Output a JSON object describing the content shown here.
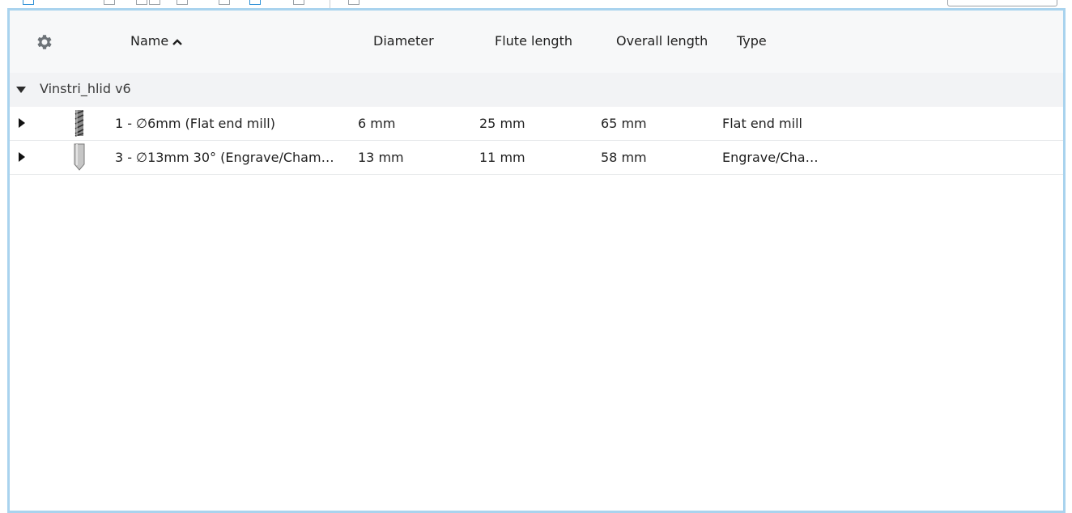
{
  "columns": {
    "name": "Name",
    "diameter": "Diameter",
    "flute_length": "Flute length",
    "overall_length": "Overall length",
    "type": "Type"
  },
  "sort": {
    "column": "Name",
    "direction": "ascending",
    "icon": "chevron-up-icon"
  },
  "settings_icon": "gear-icon",
  "group": {
    "label": "Vinstri_hlid v6",
    "expanded": true
  },
  "rows": [
    {
      "name": "1 - ∅6mm (Flat end mill)",
      "diameter": "6 mm",
      "flute_length": "25 mm",
      "overall_length": "65 mm",
      "type": "Flat end mill",
      "icon": "flat-end-mill-icon"
    },
    {
      "name": "3 - ∅13mm 30° (Engrave/Cham…",
      "diameter": "13 mm",
      "flute_length": "11 mm",
      "overall_length": "58 mm",
      "type": "Engrave/Cha…",
      "icon": "engrave-chamfer-mill-icon"
    }
  ],
  "colors": {
    "panel_border": "#a9d3ee",
    "header_bg": "#f7f8f9",
    "group_bg": "#f2f3f5"
  }
}
